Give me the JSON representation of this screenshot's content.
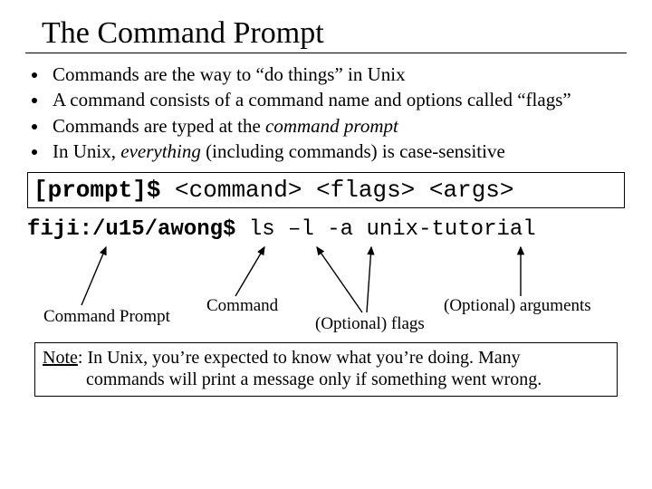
{
  "title": "The Command Prompt",
  "bullets": [
    "Commands are the way to “do things” in Unix",
    "A command consists of a command name and options called “flags”",
    "Commands are typed at the ",
    "In Unix, "
  ],
  "bullet3_emph": "command prompt",
  "bullet4_emph": "everything",
  "bullet4_tail": " (including commands) is case-sensitive",
  "syntax": {
    "prompt": "[prompt]$",
    "rest": " <command> <flags> <args>"
  },
  "example": {
    "bold": "fiji:/u15/awong$",
    "rest": " ls –l -a unix-tutorial"
  },
  "labels": {
    "cmd_prompt": "Command Prompt",
    "command": "Command",
    "opt_flags": "(Optional) flags",
    "opt_args": "(Optional) arguments"
  },
  "note": {
    "head": "Note",
    "body1": ": In Unix, you’re expected to know what you’re doing.  Many",
    "body2": "commands will print a message only if something went wrong."
  }
}
